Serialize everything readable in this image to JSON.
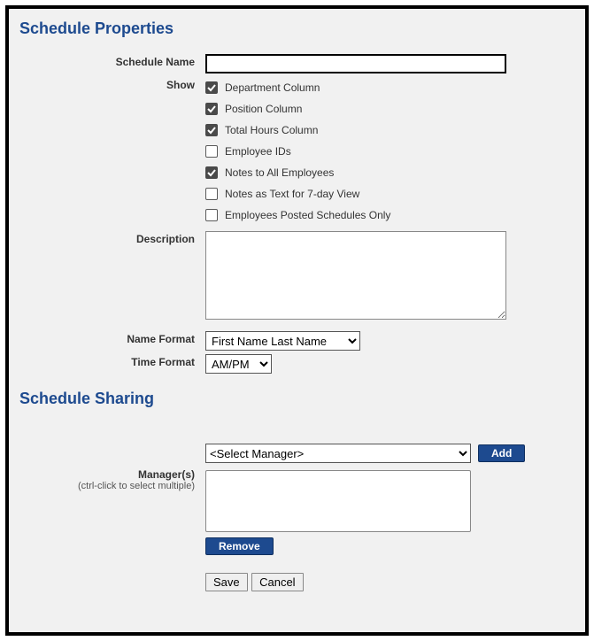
{
  "sections": {
    "properties_title": "Schedule Properties",
    "sharing_title": "Schedule Sharing"
  },
  "labels": {
    "schedule_name": "Schedule Name",
    "show": "Show",
    "description": "Description",
    "name_format": "Name Format",
    "time_format": "Time Format",
    "managers": "Manager(s)",
    "managers_hint": "(ctrl-click to select multiple)"
  },
  "fields": {
    "schedule_name_value": "",
    "description_value": "",
    "name_format_selected": "First Name Last Name",
    "time_format_selected": "AM/PM",
    "manager_dropdown_selected": "<Select Manager>"
  },
  "show_options": [
    {
      "label": "Department Column",
      "checked": true
    },
    {
      "label": "Position Column",
      "checked": true
    },
    {
      "label": "Total Hours Column",
      "checked": true
    },
    {
      "label": "Employee IDs",
      "checked": false
    },
    {
      "label": "Notes to All Employees",
      "checked": true
    },
    {
      "label": "Notes as Text for 7-day View",
      "checked": false
    },
    {
      "label": "Employees Posted Schedules Only",
      "checked": false
    }
  ],
  "buttons": {
    "add": "Add",
    "remove": "Remove",
    "save": "Save",
    "cancel": "Cancel"
  }
}
